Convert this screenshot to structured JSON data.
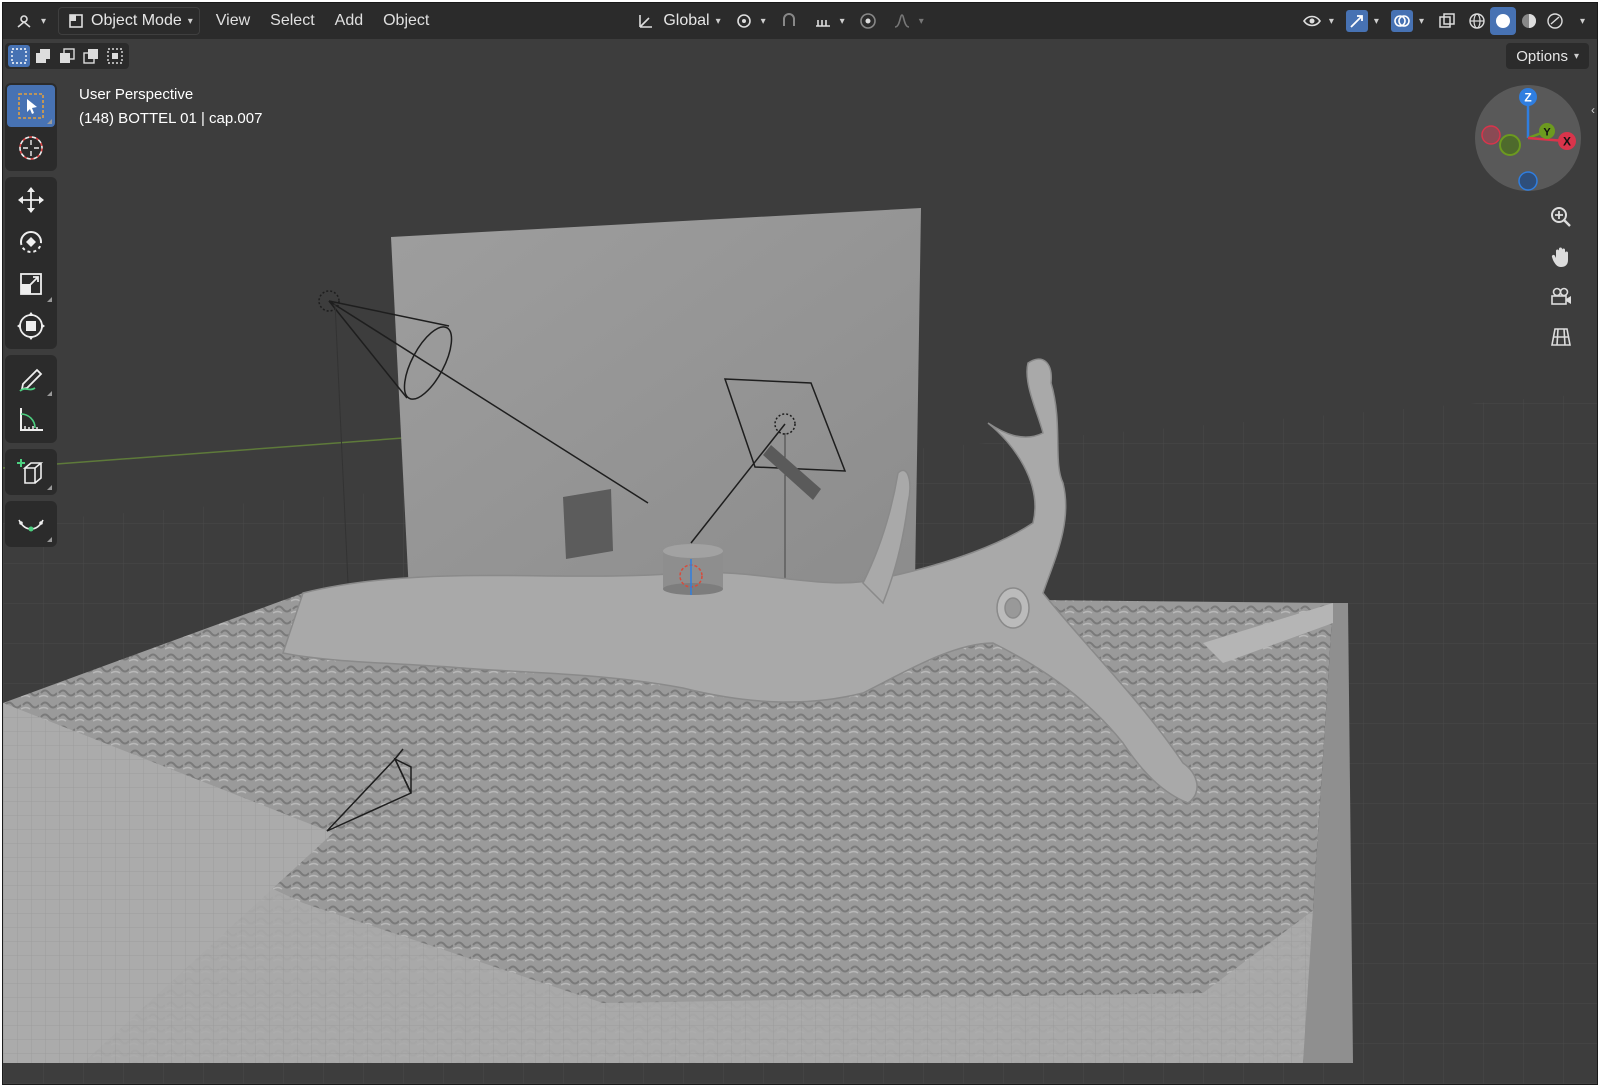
{
  "header": {
    "editor_type_icon": "3d-viewport-icon",
    "mode": "Object Mode",
    "menus": [
      "View",
      "Select",
      "Add",
      "Object"
    ],
    "transform_orientation": "Global",
    "icons": [
      "pivot-point-icon",
      "snap-icon",
      "snap-increment-icon",
      "proportional-edit-icon",
      "falloff-icon",
      "visibility-icon",
      "gizmo-icon",
      "overlay-icon",
      "xray-icon",
      "wireframe-shading-icon",
      "solid-shading-icon",
      "material-shading-icon",
      "rendered-shading-icon"
    ]
  },
  "subheader": {
    "selection_modes": [
      "select-new-icon",
      "select-extend-icon",
      "select-subtract-icon",
      "select-invert-icon",
      "select-intersect-icon"
    ],
    "options_label": "Options"
  },
  "viewport": {
    "view_name": "User Perspective",
    "active_object": "(148) BOTTEL 01 | cap.007",
    "colors": {
      "background": "#3d3d3d",
      "header": "#2b2b2b",
      "active_tool": "#4772b3",
      "axis_x": "#d9344b",
      "axis_y": "#6c9a1f",
      "axis_z": "#2f7ee0",
      "mesh": "#a8a8a8"
    }
  },
  "toolbar": {
    "tools": [
      "select-box-icon",
      "cursor-icon",
      "move-icon",
      "rotate-icon",
      "scale-icon",
      "transform-icon",
      "annotate-icon",
      "measure-icon",
      "add-cube-icon",
      "extrude-curve-icon"
    ]
  },
  "gizmo": {
    "z": "Z",
    "y": "Y",
    "x": "X"
  },
  "navigation": [
    "zoom-icon",
    "pan-hand-icon",
    "camera-view-icon",
    "ortho-grid-icon"
  ]
}
